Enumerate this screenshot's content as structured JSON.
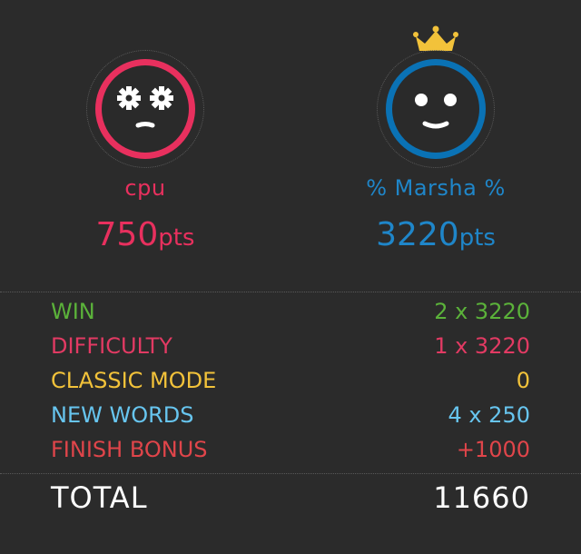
{
  "players": [
    {
      "name": "cpu",
      "score": "750",
      "unit": "pts",
      "color": "#e8305e",
      "icon": "robot-face-icon"
    },
    {
      "name": "% Marsha %",
      "score": "3220",
      "unit": "pts",
      "color": "#1f86c9",
      "icon": "smiley-face-icon",
      "badge": "crown-icon"
    }
  ],
  "breakdown": [
    {
      "label": "WIN",
      "value": "2 x 3220",
      "color": "#5bb23a"
    },
    {
      "label": "DIFFICULTY",
      "value": "1 x 3220",
      "color": "#e23a63"
    },
    {
      "label": "CLASSIC MODE",
      "value": "0",
      "color": "#f2c23a"
    },
    {
      "label": "NEW WORDS",
      "value": "4 x 250",
      "color": "#67c5ef"
    },
    {
      "label": "FINISH BONUS",
      "value": "+1000",
      "color": "#e0454a"
    }
  ],
  "total": {
    "label": "TOTAL",
    "value": "11660"
  }
}
